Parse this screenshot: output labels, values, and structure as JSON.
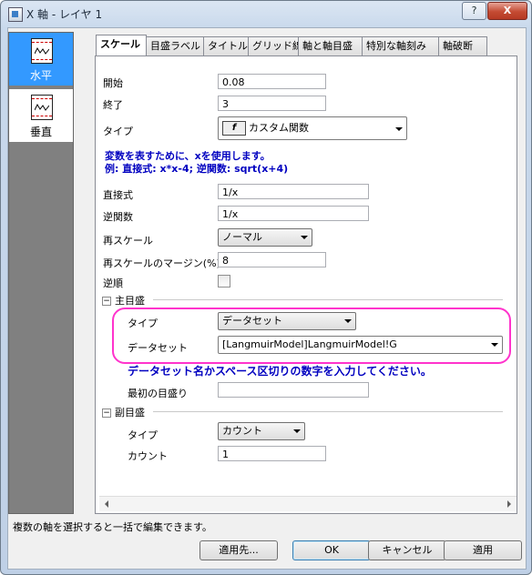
{
  "window": {
    "title": "X 軸 - レイヤ 1",
    "help": "?",
    "close": "X"
  },
  "left_panel": {
    "items": [
      {
        "label": "水平",
        "selected": true
      },
      {
        "label": "垂直",
        "selected": false
      }
    ]
  },
  "tabs": [
    "スケール",
    "目盛ラベル",
    "タイトル",
    "グリッド線",
    "軸と軸目盛",
    "特別な軸刻み",
    "軸破断"
  ],
  "scale": {
    "start_label": "開始",
    "start_value": "0.08",
    "end_label": "終了",
    "end_value": "3",
    "type_label": "タイプ",
    "type_value": "カスタム関数",
    "hint_line1": "変数を表すために、xを使用します。",
    "hint_line2": "例: 直接式: x*x-4; 逆関数: sqrt(x+4)",
    "direct_label": "直接式",
    "direct_value": "1/x",
    "inverse_label": "逆関数",
    "inverse_value": "1/x",
    "rescale_label": "再スケール",
    "rescale_value": "ノーマル",
    "margin_label": "再スケールのマージン(%)",
    "margin_value": "8",
    "reverse_label": "逆順",
    "reverse_checked": false
  },
  "major": {
    "group_label": "主目盛",
    "type_label": "タイプ",
    "type_value": "データセット",
    "dataset_label": "データセット",
    "dataset_value": "[LangmuirModel]LangmuirModel!G",
    "hint": "データセット名かスペース区切りの数字を入力してください。",
    "first_tick_label": "最初の目盛り",
    "first_tick_value": ""
  },
  "minor": {
    "group_label": "副目盛",
    "type_label": "タイプ",
    "type_value": "カウント",
    "count_label": "カウント",
    "count_value": "1"
  },
  "status_text": "複数の軸を選択すると一括で編集できます。",
  "buttons": {
    "apply_to": "適用先...",
    "ok": "OK",
    "cancel": "キャンセル",
    "apply": "適用"
  },
  "colors": {
    "accent": "#3399ff",
    "hint": "#0000c0",
    "highlight": "#ff33cc"
  }
}
